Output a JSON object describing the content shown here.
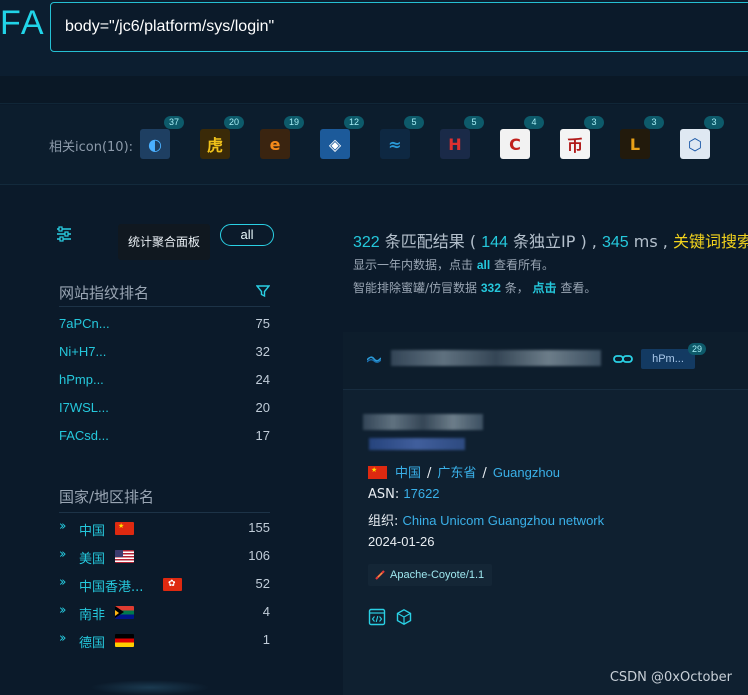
{
  "header": {
    "logo": "FA",
    "search_value": "body=\"/jc6/platform/sys/login\""
  },
  "icon_row": {
    "label": "相关icon(10):",
    "icons": [
      {
        "name": "globe-swirl-icon",
        "count": "37",
        "bg": "#1e3f62",
        "fg": "#4ab0ff",
        "glyph": "◐"
      },
      {
        "name": "tiger-logo-icon",
        "count": "20",
        "bg": "#3a2a08",
        "fg": "#f0c21a",
        "glyph": "虎"
      },
      {
        "name": "e-logo-icon",
        "count": "19",
        "bg": "#3a2410",
        "fg": "#f58a1a",
        "glyph": "e"
      },
      {
        "name": "cube-logo-icon",
        "count": "12",
        "bg": "#1c5a9a",
        "fg": "#ffffff",
        "glyph": "◈"
      },
      {
        "name": "wave-logo-icon",
        "count": "5",
        "bg": "#0e2842",
        "fg": "#2a9ad8",
        "glyph": "≈"
      },
      {
        "name": "hb-logo-icon",
        "count": "5",
        "bg": "#1a2a48",
        "fg": "#e03030",
        "glyph": "H"
      },
      {
        "name": "cebc-logo-icon",
        "count": "4",
        "bg": "#f2f2f2",
        "fg": "#c0201c",
        "glyph": "C"
      },
      {
        "name": "red-emblem-icon",
        "count": "3",
        "bg": "#f4f4f4",
        "fg": "#b01818",
        "glyph": "币"
      },
      {
        "name": "l-logo-icon",
        "count": "3",
        "bg": "#221a0c",
        "fg": "#e8a018",
        "glyph": "L"
      },
      {
        "name": "hexagon-logo-icon",
        "count": "3",
        "bg": "#dfe8f2",
        "fg": "#1a58a8",
        "glyph": "⬡"
      }
    ]
  },
  "left_panel": {
    "tooltip": "统计聚合面板",
    "all_button": "all",
    "fingerprint": {
      "title": "网站指纹排名",
      "items": [
        {
          "name": "7aPCn...",
          "count": "75"
        },
        {
          "name": "Ni+H7...",
          "count": "32"
        },
        {
          "name": "hPmp...",
          "count": "24"
        },
        {
          "name": "I7WSL...",
          "count": "20"
        },
        {
          "name": "FACsd...",
          "count": "17"
        }
      ]
    },
    "country": {
      "title": "国家/地区排名",
      "items": [
        {
          "name": "中国",
          "count": "155",
          "flag": "cn"
        },
        {
          "name": "美国",
          "count": "106",
          "flag": "us"
        },
        {
          "name": "中国香港...",
          "count": "52",
          "flag": "hk"
        },
        {
          "name": "南非",
          "count": "4",
          "flag": "za"
        },
        {
          "name": "德国",
          "count": "1",
          "flag": "de"
        }
      ]
    }
  },
  "results": {
    "count": "322",
    "count_label": " 条匹配结果 ( ",
    "unique": "144",
    "unique_label": " 条独立IP ) ,  ",
    "ms": "345",
    "ms_label": " ms ,  ",
    "keyword_label": "关键词搜索",
    "note1_prefix": "显示一年内数据，点击 ",
    "note1_link": "all",
    "note1_suffix": " 查看所有。",
    "note2_prefix": "智能排除蜜罐/仿冒数据 ",
    "note2_count": "332",
    "note2_mid": " 条，  ",
    "note2_link": "点击",
    "note2_suffix": " 查看。"
  },
  "card": {
    "tag_label": "hPm...",
    "tag_count": "29",
    "country": "中国",
    "province": "广东省",
    "city": "Guangzhou",
    "asn_label": "ASN: ",
    "asn": "17622",
    "org_label": "组织: ",
    "org": "China Unicom Guangzhou network",
    "date": "2024-01-26",
    "server": "Apache-Coyote/1.1"
  },
  "watermark": "CSDN @0xOctober"
}
